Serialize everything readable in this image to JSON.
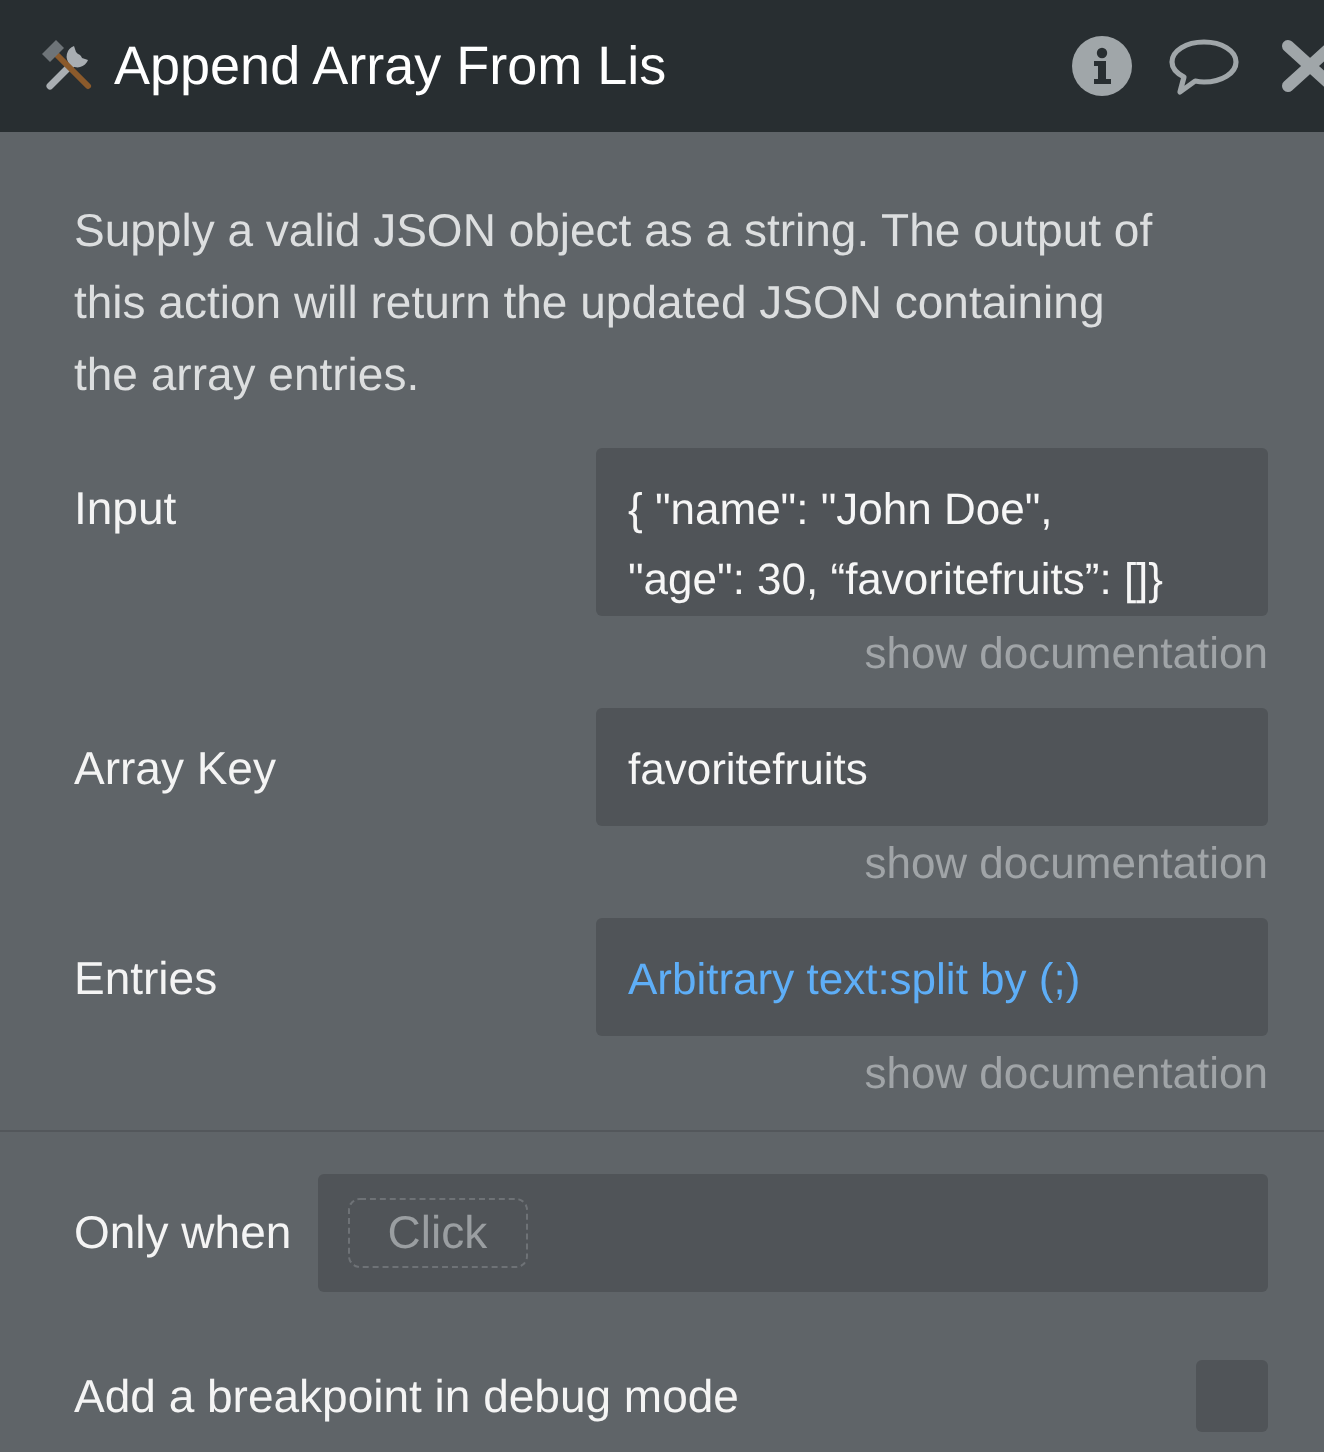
{
  "window": {
    "title": "Append Array From Lis"
  },
  "description": "Supply a valid JSON object as a string. The output of this action will return the updated JSON containing the array entries.",
  "fields": [
    {
      "label": "Input",
      "value": "{ \"name\": \"John Doe\",\n\"age\": 30, “favoritefruits”: []}",
      "kind": "text",
      "doc_link": "show documentation"
    },
    {
      "label": "Array Key",
      "value": "favoritefruits",
      "kind": "text",
      "doc_link": "show documentation"
    },
    {
      "label": "Entries",
      "value": "Arbitrary text:split by (;)",
      "kind": "expression",
      "doc_link": "show documentation"
    }
  ],
  "only_when": {
    "label": "Only when",
    "placeholder": "Click"
  },
  "breakpoint": {
    "label": "Add a breakpoint in debug mode",
    "checked": false
  }
}
